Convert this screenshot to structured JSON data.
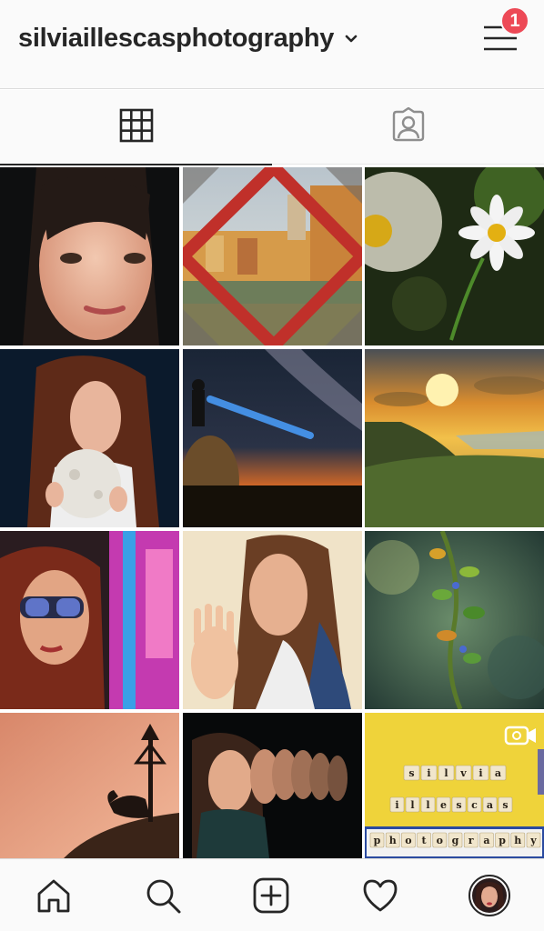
{
  "header": {
    "username": "silviaillescasphotography",
    "switch_icon": "chevron-down-icon",
    "menu_icon": "hamburger-menu-icon",
    "notification_count": "1",
    "badge_color": "#ed4956"
  },
  "tabs": [
    {
      "name": "grid",
      "icon": "grid-icon",
      "active": true
    },
    {
      "name": "tagged",
      "icon": "tagged-person-icon",
      "active": false
    }
  ],
  "posts": [
    {
      "subject": "girl-portrait",
      "type": "photo"
    },
    {
      "subject": "river-town-in-red-frame",
      "type": "photo"
    },
    {
      "subject": "daisy-flowers",
      "type": "photo"
    },
    {
      "subject": "woman-holding-moon-lamp",
      "type": "photo"
    },
    {
      "subject": "milky-way-with-flashlight",
      "type": "photo"
    },
    {
      "subject": "coastal-sunset",
      "type": "photo"
    },
    {
      "subject": "woman-with-sunglasses-neon",
      "type": "photo"
    },
    {
      "subject": "woman-hand-on-glass",
      "type": "photo"
    },
    {
      "subject": "plant-macro",
      "type": "photo"
    },
    {
      "subject": "rooster-silhouette-sculpture",
      "type": "photo"
    },
    {
      "subject": "repeated-face-portrait",
      "type": "photo"
    },
    {
      "subject": "letter-tiles",
      "type": "video",
      "tiles": [
        "s",
        "i",
        "l",
        "v",
        "i",
        "a",
        "i",
        "l",
        "l",
        "e",
        "s",
        "c",
        "a",
        "s",
        "p",
        "h",
        "o",
        "t",
        "o",
        "g",
        "r",
        "a",
        "p",
        "h",
        "y"
      ]
    }
  ],
  "bottom_nav": [
    {
      "name": "home",
      "icon": "home-icon"
    },
    {
      "name": "search",
      "icon": "search-icon"
    },
    {
      "name": "new-post",
      "icon": "add-post-icon"
    },
    {
      "name": "activity",
      "icon": "heart-icon"
    },
    {
      "name": "profile",
      "icon": "profile-avatar"
    }
  ]
}
